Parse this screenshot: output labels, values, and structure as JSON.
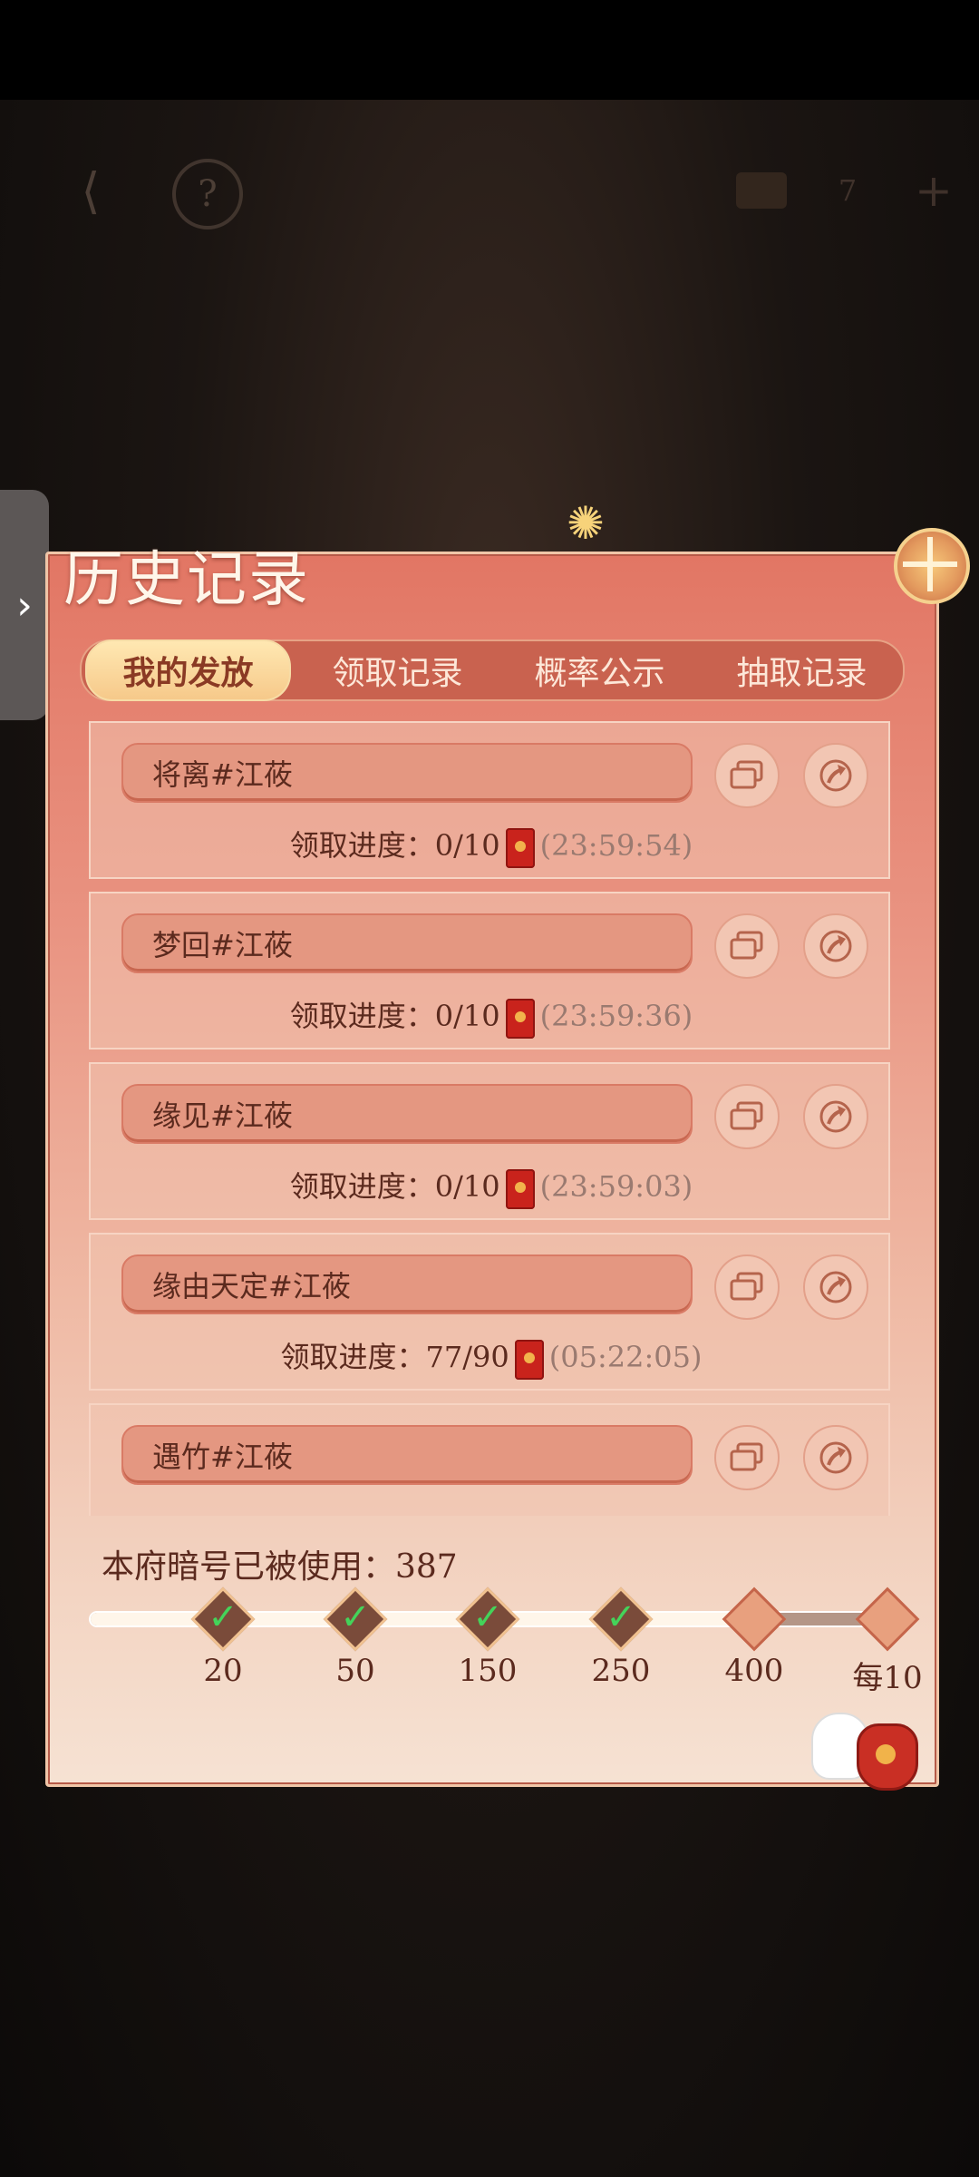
{
  "hud": {
    "back": "⟨",
    "help": "?",
    "count": "7",
    "plus": "+"
  },
  "side_tab": {
    "arrow": "›"
  },
  "panel": {
    "title": "历史记录"
  },
  "tabs": [
    {
      "label": "我的发放",
      "active": true
    },
    {
      "label": "领取记录",
      "active": false
    },
    {
      "label": "概率公示",
      "active": false
    },
    {
      "label": "抽取记录",
      "active": false
    }
  ],
  "records": [
    {
      "name": "将离#江莜",
      "progress_label": "领取进度：0/10",
      "time": "(23:59:54)"
    },
    {
      "name": "梦回#江莜",
      "progress_label": "领取进度：0/10",
      "time": "(23:59:36)"
    },
    {
      "name": "缘见#江莜",
      "progress_label": "领取进度：0/10",
      "time": "(23:59:03)"
    },
    {
      "name": "缘由天定#江莜",
      "progress_label": "领取进度：77/90",
      "time": "(05:22:05)"
    },
    {
      "name": "遇竹#江莜",
      "progress_label": "",
      "time": ""
    }
  ],
  "usage": {
    "text": "本府暗号已被使用：387",
    "fill_fraction": 0.83,
    "milestones": [
      {
        "label": "20",
        "done": true
      },
      {
        "label": "50",
        "done": true
      },
      {
        "label": "150",
        "done": true
      },
      {
        "label": "250",
        "done": true
      },
      {
        "label": "400",
        "done": false
      },
      {
        "label": "每10",
        "done": false
      }
    ]
  }
}
